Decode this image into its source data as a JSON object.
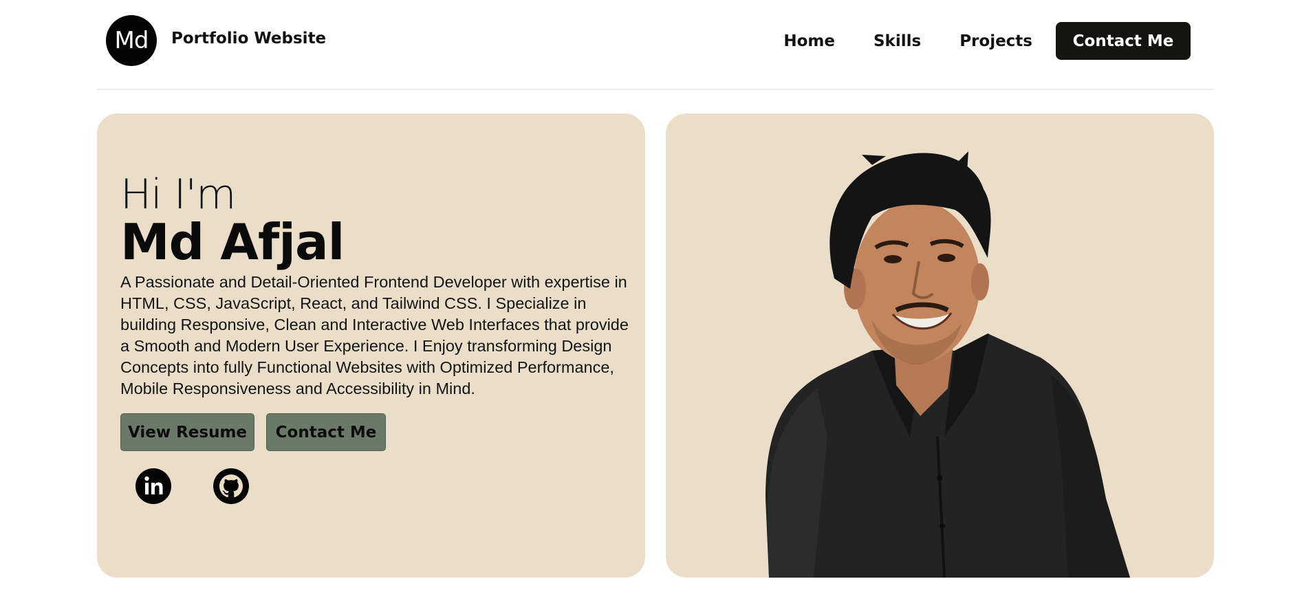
{
  "header": {
    "logo_text": "Md",
    "brand": "Portfolio Website",
    "nav": [
      "Home",
      "Skills",
      "Projects"
    ],
    "cta": "Contact Me"
  },
  "hero": {
    "greeting": "Hi I'm",
    "name": "Md Afjal",
    "bio": "A Passionate and Detail-Oriented Frontend Developer with expertise in HTML, CSS, JavaScript, React, and Tailwind CSS. I Specialize in building Responsive, Clean and Interactive Web Interfaces that provide a Smooth and Modern User Experience. I Enjoy transforming Design Concepts into fully Functional Websites with Optimized Performance, Mobile Responsiveness and Accessibility in Mind.",
    "resume_button": "View Resume",
    "contact_button": "Contact Me",
    "socials": [
      "linkedin-icon",
      "github-icon"
    ]
  },
  "colors": {
    "card_bg": "#ebdec9",
    "button_bg": "#6a7968",
    "nav_cta_bg": "#14150f"
  }
}
